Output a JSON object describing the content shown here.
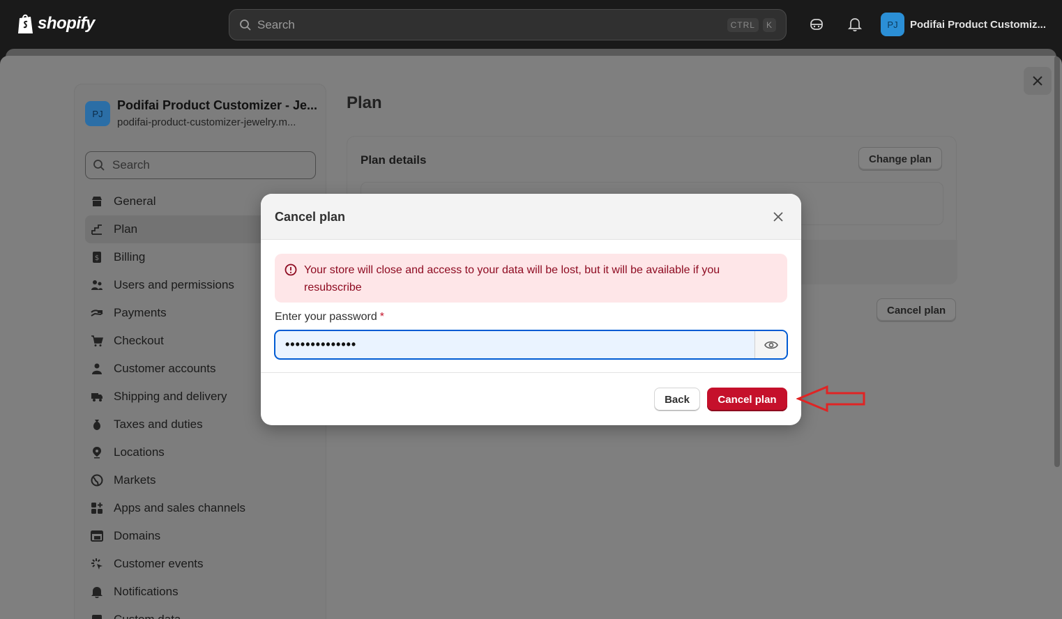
{
  "topbar": {
    "logo_text": "shopify",
    "search_placeholder": "Search",
    "shortcut_ctrl": "CTRL",
    "shortcut_key": "K",
    "store_initials": "PJ",
    "store_name": "Podifai Product Customiz..."
  },
  "sidebar": {
    "store_initials": "PJ",
    "store_title": "Podifai Product Customizer - Je...",
    "store_url": "podifai-product-customizer-jewelry.m...",
    "search_placeholder": "Search",
    "items": [
      {
        "label": "General",
        "icon": "store-icon"
      },
      {
        "label": "Plan",
        "icon": "plan-icon",
        "active": true
      },
      {
        "label": "Billing",
        "icon": "billing-icon"
      },
      {
        "label": "Users and permissions",
        "icon": "users-icon"
      },
      {
        "label": "Payments",
        "icon": "payments-icon"
      },
      {
        "label": "Checkout",
        "icon": "cart-icon"
      },
      {
        "label": "Customer accounts",
        "icon": "person-icon"
      },
      {
        "label": "Shipping and delivery",
        "icon": "truck-icon"
      },
      {
        "label": "Taxes and duties",
        "icon": "tax-icon"
      },
      {
        "label": "Locations",
        "icon": "location-icon"
      },
      {
        "label": "Markets",
        "icon": "globe-icon"
      },
      {
        "label": "Apps and sales channels",
        "icon": "apps-icon"
      },
      {
        "label": "Domains",
        "icon": "domains-icon"
      },
      {
        "label": "Customer events",
        "icon": "events-icon"
      },
      {
        "label": "Notifications",
        "icon": "bell-icon"
      },
      {
        "label": "Custom data",
        "icon": "data-icon"
      }
    ]
  },
  "main": {
    "page_title": "Plan",
    "plan_details_heading": "Plan details",
    "change_plan_label": "Change plan",
    "cancel_plan_label": "Cancel plan"
  },
  "modal": {
    "title": "Cancel plan",
    "banner_text": "Your store will close and access to your data will be lost, but it will be available if you resubscribe",
    "password_label": "Enter your password",
    "required_marker": "*",
    "password_value": "••••••••••••••",
    "back_label": "Back",
    "cancel_plan_label": "Cancel plan"
  },
  "colors": {
    "critical": "#c5102b",
    "banner_bg": "#fee6e8",
    "focus": "#005bd3",
    "annotation_arrow": "#e02424"
  }
}
